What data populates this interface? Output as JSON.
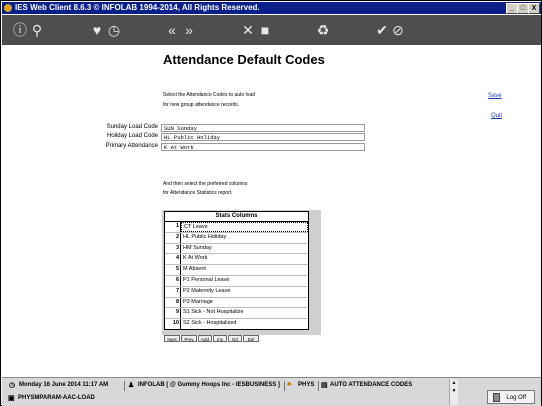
{
  "window": {
    "title": "IES Web Client 8.6.3 © INFOLAB 1994-2014, All Rights Reserved.",
    "minimize": "_",
    "maximize": "□",
    "close": "X"
  },
  "toolbar": {
    "icons": [
      "info-icon",
      "search-icon",
      "heart-icon",
      "clock-icon",
      "double-left-icon",
      "double-right-icon",
      "tools-icon",
      "square-icon",
      "recycle-icon",
      "check-icon",
      "cancel-icon"
    ]
  },
  "page": {
    "title": "Attendance Default Codes",
    "intro_line1": "Select the Attendance Codes to auto load",
    "intro_line2": "for new group attendance records.",
    "save_link": "Save",
    "quit_link": "Quit"
  },
  "fields": {
    "sunday": {
      "label": "Sunday Load Code",
      "value": "SUN Sunday"
    },
    "holiday": {
      "label": "Holiday Load Code",
      "value": "HL Public Holiday"
    },
    "primary": {
      "label": "Primary Attendance",
      "value": "K At Work"
    }
  },
  "stats": {
    "intro_line1": "And then select the preferred columns",
    "intro_line2": "for Attendance Statistics report.",
    "header": "Stats Columns",
    "rows": [
      {
        "num": "1",
        "text": "CT Leave"
      },
      {
        "num": "2",
        "text": "HL Public Holiday"
      },
      {
        "num": "3",
        "text": "HM Sunday"
      },
      {
        "num": "4",
        "text": "K At Work"
      },
      {
        "num": "5",
        "text": "M Absent"
      },
      {
        "num": "6",
        "text": "P1 Personal Leave"
      },
      {
        "num": "7",
        "text": "P2 Maternity Leave"
      },
      {
        "num": "8",
        "text": "P3 Marriage"
      },
      {
        "num": "9",
        "text": "S1 Sick - Not Hospitalize"
      },
      {
        "num": "10",
        "text": "S2 Sick - Hospitalized"
      }
    ],
    "buttons": [
      "Next",
      "Prev",
      "Add",
      "Ins",
      "Ed",
      "Del"
    ]
  },
  "taskbar": {
    "date": "Monday 16 June 2014 11:17 AM",
    "org": "INFOLAB [ @ Gummy Hoops Inc - IESBUSINESS ]",
    "user": "PHYS",
    "current": "AUTO ATTENDANCE CODES",
    "program": "PHYSMPARAM-AAC-LOAD",
    "logoff": "Log Off"
  }
}
